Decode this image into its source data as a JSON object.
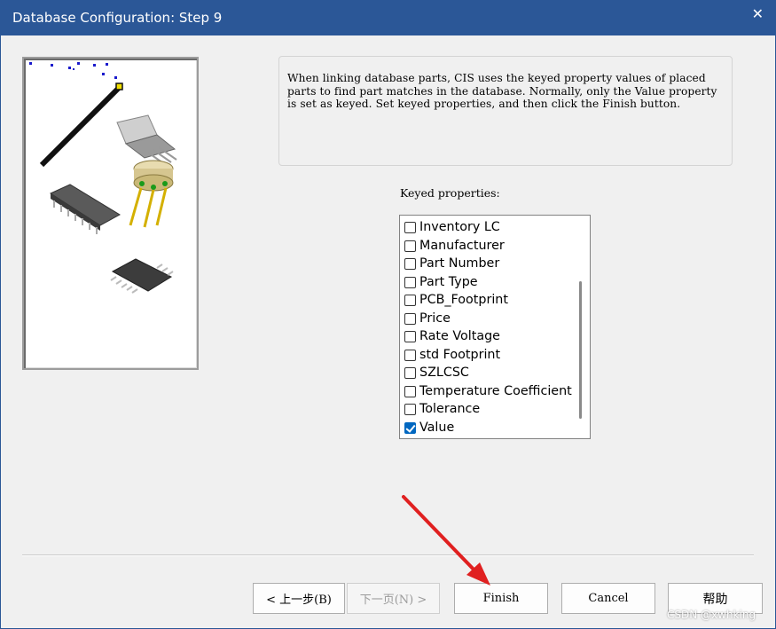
{
  "window": {
    "title": "Database Configuration: Step 9",
    "close_glyph": "✕"
  },
  "description": "When linking database parts, CIS uses the keyed property values of placed parts to find part matches in the database. Normally, only the Value property is set as keyed. Set keyed properties, and then click the Finish button.",
  "keyed_properties": {
    "label": "Keyed properties:",
    "items": [
      {
        "label": "Inventory LC",
        "checked": false
      },
      {
        "label": "Manufacturer",
        "checked": false
      },
      {
        "label": "Part Number",
        "checked": false
      },
      {
        "label": "Part Type",
        "checked": false
      },
      {
        "label": "PCB_Footprint",
        "checked": false
      },
      {
        "label": "Price",
        "checked": false
      },
      {
        "label": "Rate Voltage",
        "checked": false
      },
      {
        "label": "std Footprint",
        "checked": false
      },
      {
        "label": "SZLCSC",
        "checked": false
      },
      {
        "label": "Temperature Coefficient",
        "checked": false
      },
      {
        "label": "Tolerance",
        "checked": false
      },
      {
        "label": "Value",
        "checked": true
      }
    ]
  },
  "buttons": {
    "back": "< 上一步(B)",
    "next": "下一页(N) >",
    "finish": "Finish",
    "cancel": "Cancel",
    "help": "帮助"
  },
  "watermark": "CSDN @xwhking",
  "colors": {
    "titlebar": "#2b5797",
    "checkbox_checked": "#0067c0",
    "annotation_arrow": "#e02020"
  }
}
